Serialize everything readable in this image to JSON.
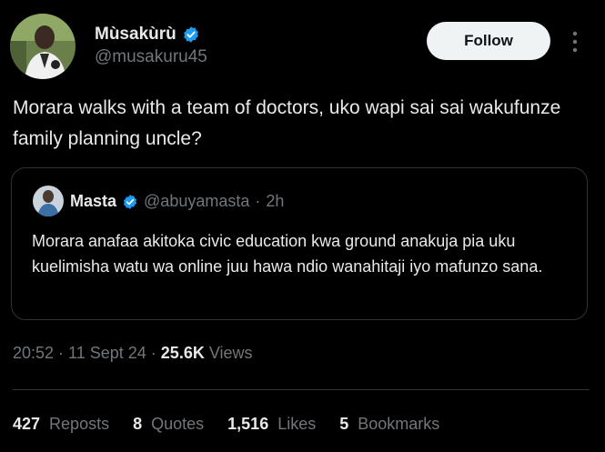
{
  "author": {
    "display_name": "Mùsakùrù",
    "handle": "@musakuru45",
    "verified_icon": "verified-badge-icon"
  },
  "actions": {
    "follow_label": "Follow",
    "more_icon": "more-vertical-icon"
  },
  "tweet": {
    "text": "Morara walks with a team of doctors, uko wapi sai sai wakufunze family planning uncle?"
  },
  "quote": {
    "display_name": "Masta",
    "handle": "@abuyamasta",
    "separator": "·",
    "time": "2h",
    "text": "Morara anafaa akitoka civic education kwa ground anakuja pia uku kuelimisha watu wa online juu hawa ndio wanahitaji iyo mafunzo sana."
  },
  "meta": {
    "time": "20:52",
    "separator": "·",
    "date": "11 Sept 24",
    "views_count": "25.6K",
    "views_label": "Views"
  },
  "stats": [
    {
      "count": "427",
      "label": "Reposts"
    },
    {
      "count": "8",
      "label": "Quotes"
    },
    {
      "count": "1,516",
      "label": "Likes"
    },
    {
      "count": "5",
      "label": "Bookmarks"
    }
  ],
  "colors": {
    "background": "#000000",
    "text_primary": "#e7e9ea",
    "text_secondary": "#71767b",
    "verified": "#1d9bf0",
    "border": "#2f3336",
    "button_bg": "#eff3f4"
  }
}
